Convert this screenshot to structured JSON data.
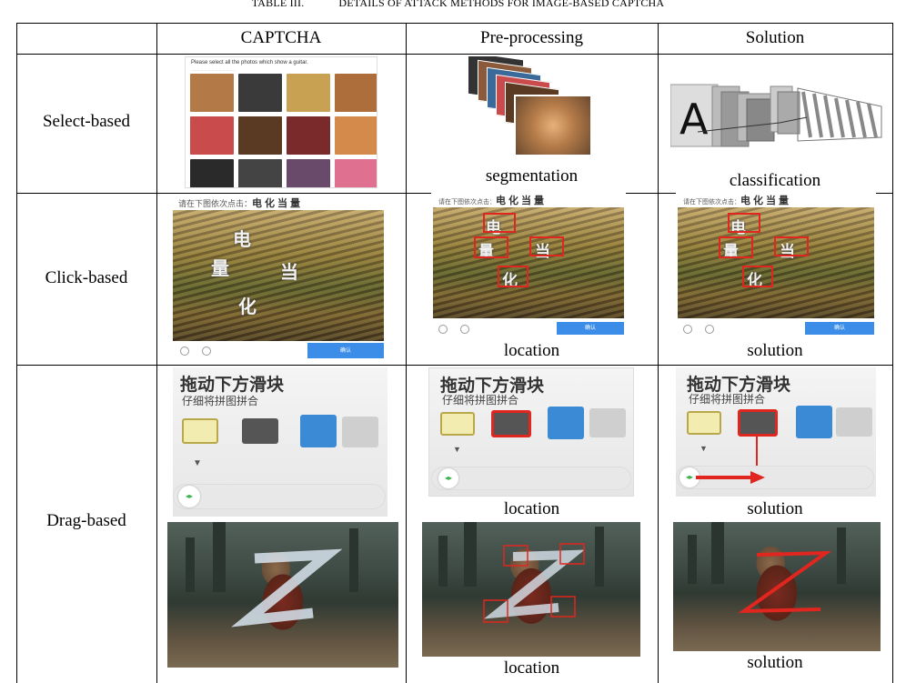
{
  "caption": {
    "number": "TABLE III.",
    "title": "DETAILS OF ATTACK METHODS FOR IMAGE-BASED CAPTCHA"
  },
  "headers": {
    "col1": "CAPTCHA",
    "col2": "Pre-processing",
    "col3": "Solution"
  },
  "rows": {
    "select": {
      "label": "Select-based",
      "pre_caption": "segmentation",
      "sol_caption": "classification"
    },
    "click": {
      "label": "Click-based",
      "pre_caption": "location",
      "sol_caption": "solution"
    },
    "drag": {
      "label": "Drag-based",
      "puzzle_pre_caption": "location",
      "puzzle_sol_caption": "solution",
      "photo_pre_caption": "location",
      "photo_sol_caption": "solution"
    }
  },
  "select_captcha": {
    "instruction": "Please select all the photos which show a guitar.",
    "tiles": [
      "#b37a48",
      "#3a3a3a",
      "#c9a152",
      "#ad6e3c",
      "#c94b4b",
      "#5a3a22",
      "#7a2a2a",
      "#d48a4a",
      "#2a2a2a",
      "#444444",
      "#6a4a6a",
      "#e07090"
    ]
  },
  "click_captcha": {
    "prompt_prefix": "请在下图依次点击：",
    "prompt_chars": "电化当量",
    "chars": [
      "电",
      "量",
      "当",
      "化"
    ],
    "confirm_label": "确认"
  },
  "drag_captcha": {
    "title": "拖动下方滑块",
    "subtitle": "仔细将拼图拼合"
  },
  "colors": {
    "highlight": "#e0261e",
    "button": "#3c8de8"
  }
}
